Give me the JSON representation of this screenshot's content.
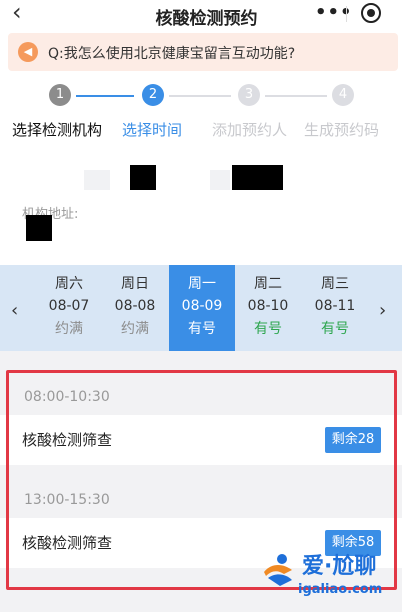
{
  "header": {
    "back_icon": "‹",
    "title": "核酸检测预约",
    "more_icon": "•••"
  },
  "notice": {
    "icon": "speaker-icon",
    "text": "Q:我怎么使用北京健康宝留言互动功能?"
  },
  "steps": [
    {
      "num": "1",
      "label": "选择检测机构",
      "state": "done"
    },
    {
      "num": "2",
      "label": "选择时间",
      "state": "active"
    },
    {
      "num": "3",
      "label": "添加预约人",
      "state": "todo"
    },
    {
      "num": "4",
      "label": "生成预约码",
      "state": "todo"
    }
  ],
  "colors": {
    "active": "#3a8ee6",
    "done": "#8c8c8c",
    "todo": "#dcdde2",
    "available": "#2ea64f",
    "full": "#8c8c8c",
    "highlight": "#e23845"
  },
  "institution": {
    "address_label": "机构地址:"
  },
  "date_nav": {
    "prev_icon": "‹",
    "next_icon": "›",
    "days": [
      {
        "weekday": "周六",
        "date": "08-07",
        "status": "约满"
      },
      {
        "weekday": "周日",
        "date": "08-08",
        "status": "约满"
      },
      {
        "weekday": "周一",
        "date": "08-09",
        "status": "有号",
        "selected": true
      },
      {
        "weekday": "周二",
        "date": "08-10",
        "status": "有号"
      },
      {
        "weekday": "周三",
        "date": "08-11",
        "status": "有号"
      }
    ]
  },
  "slots": [
    {
      "time": "08:00-10:30",
      "service": "核酸检测筛查",
      "remaining": "剩余28"
    },
    {
      "time": "13:00-15:30",
      "service": "核酸检测筛查",
      "remaining": "剩余58"
    }
  ],
  "watermark": {
    "text": "爱·尬聊",
    "url": "igaliao.com"
  }
}
